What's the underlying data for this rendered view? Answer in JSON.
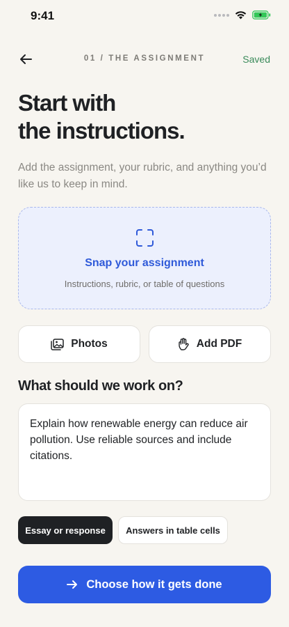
{
  "status_bar": {
    "time": "9:41"
  },
  "nav": {
    "step": "01 / THE ASSIGNMENT",
    "saved": "Saved"
  },
  "header": {
    "title_line1": "Start with",
    "title_line2": "the instructions.",
    "subtitle": "Add the assignment, your rubric, and anything you’d like us to keep in mind."
  },
  "upload": {
    "title": "Snap your assignment",
    "subtitle": "Instructions, rubric, or table of questions",
    "icon": "scan-icon"
  },
  "sources": {
    "photos_label": "Photos",
    "pdf_label": "Add PDF"
  },
  "prompt": {
    "section_title": "What should we work on?",
    "text": "Explain how renewable energy can reduce air pollution. Use reliable sources and include citations."
  },
  "modes": {
    "essay_label": "Essay or response",
    "table_label": "Answers in table cells",
    "selected": "Essay or response"
  },
  "cta": {
    "label": "Choose how it gets done"
  },
  "colors": {
    "accent": "#2d5be3",
    "saved": "#3a8a5a",
    "background": "#f7f5f0",
    "battery": "#34c759"
  }
}
